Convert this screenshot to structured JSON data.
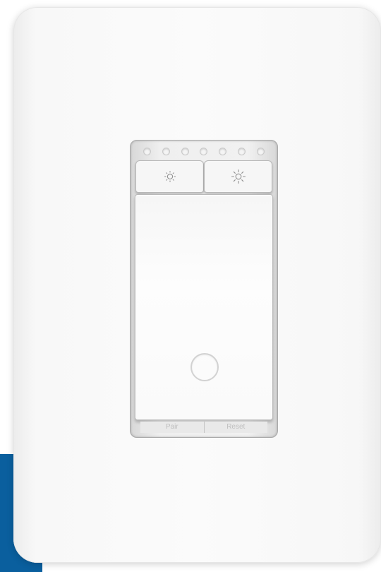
{
  "colors": {
    "accent": "#0a5f9e",
    "plate": "#fbfbfb",
    "frame": "#efefef"
  },
  "switch": {
    "led_count": 7,
    "buttons": [
      {
        "icon": "sun-dim-icon"
      },
      {
        "icon": "sun-bright-icon"
      }
    ],
    "bottom_labels": [
      "Pair",
      "Reset"
    ]
  }
}
